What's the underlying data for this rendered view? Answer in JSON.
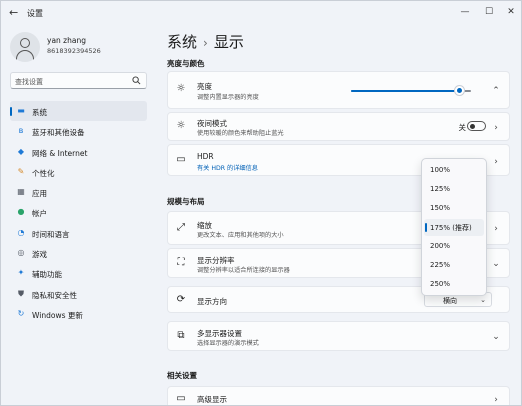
{
  "window": {
    "back_glyph": "←",
    "title": "设置",
    "min_glyph": "—",
    "max_glyph": "☐",
    "close_glyph": "✕"
  },
  "user": {
    "name": "yan zhang",
    "account": "8618392394526"
  },
  "search": {
    "placeholder": "查找设置"
  },
  "sidebar": {
    "items": [
      {
        "label": "系统",
        "icon": "system-display-icon",
        "color": "#1f7ad6",
        "active": true
      },
      {
        "label": "蓝牙和其他设备",
        "icon": "bluetooth-icon",
        "color": "#1f7ad6"
      },
      {
        "label": "网络 & Internet",
        "icon": "wifi-icon",
        "color": "#1f7ad6"
      },
      {
        "label": "个性化",
        "icon": "brush-icon",
        "color": "#d68a2a"
      },
      {
        "label": "应用",
        "icon": "apps-icon",
        "color": "#555b66"
      },
      {
        "label": "帐户",
        "icon": "account-icon",
        "color": "#2aa36a"
      },
      {
        "label": "时间和语言",
        "icon": "globe-clock-icon",
        "color": "#1f7ad6"
      },
      {
        "label": "游戏",
        "icon": "gamepad-icon",
        "color": "#555b66"
      },
      {
        "label": "辅助功能",
        "icon": "accessibility-icon",
        "color": "#1f7ad6"
      },
      {
        "label": "隐私和安全性",
        "icon": "shield-icon",
        "color": "#555b66"
      },
      {
        "label": "Windows 更新",
        "icon": "update-icon",
        "color": "#1f7ad6"
      }
    ]
  },
  "breadcrumb": {
    "parent": "系统",
    "separator": "›",
    "current": "显示"
  },
  "sections": {
    "brightness_color": "亮度与颜色",
    "scale_layout": "规模与布局",
    "related": "相关设置"
  },
  "cards": {
    "brightness": {
      "title": "亮度",
      "subtitle": "调整内置显示器的亮度",
      "level_percent": 90
    },
    "night_light": {
      "title": "夜间模式",
      "subtitle": "使用较暖的颜色来帮助阻止蓝光",
      "toggle_label": "关",
      "on": false
    },
    "hdr": {
      "title": "HDR",
      "subtitle": "有关 HDR 的详细信息"
    },
    "scale": {
      "title": "缩放",
      "subtitle": "更改文本、应用和其他项的大小"
    },
    "resolution": {
      "title": "显示分辨率",
      "subtitle": "调整分辨率以适合所连接的显示器"
    },
    "orientation": {
      "title": "显示方向",
      "value": "横向"
    },
    "multi_display": {
      "title": "多显示器设置",
      "subtitle": "选择显示器的演示模式"
    },
    "advanced": {
      "title": "高级显示"
    }
  },
  "scale_dropdown": {
    "options": [
      "100%",
      "125%",
      "150%",
      "175% (推荐)",
      "200%",
      "225%",
      "250%"
    ],
    "selected_index": 3
  },
  "colors": {
    "accent": "#0067c0",
    "background": "#f0f3f8",
    "card": "#fbfcfd"
  }
}
